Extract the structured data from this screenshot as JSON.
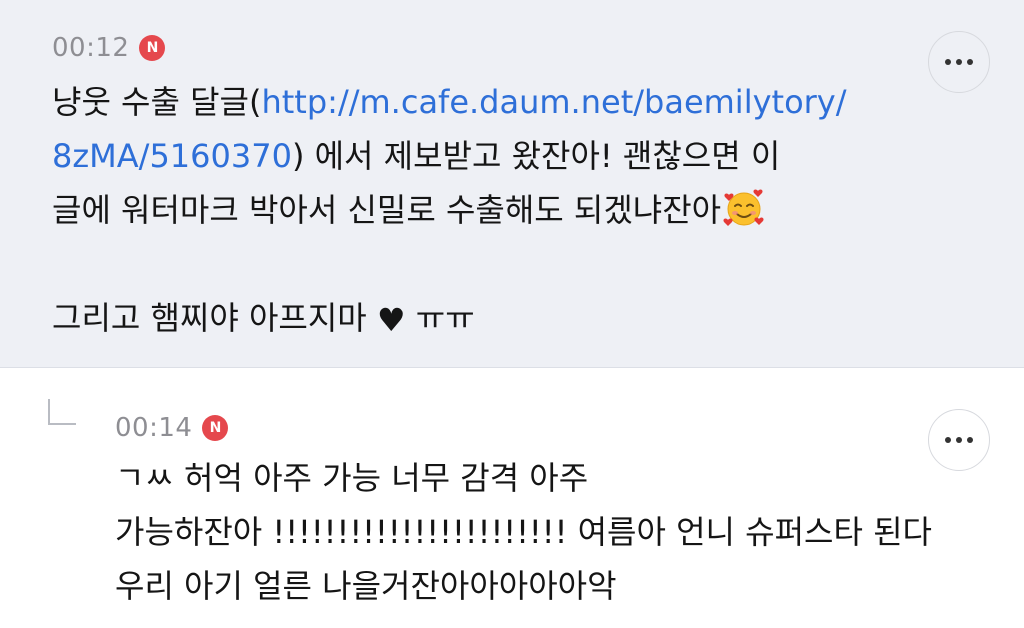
{
  "comments": [
    {
      "time": "00:12",
      "badge": "N",
      "lines": {
        "l1_text": "냥웃 수출 달글(",
        "l1_link": "http://m.cafe.daum.net/baemilytory/",
        "l2_link": "8zMA/5160370",
        "l2_text": ") 에서 제보받고 왔잔아! 괜찮으면 이",
        "l3_text": "글에 워터마크 박아서 신밀로 수출해도 되겠냐잔아",
        "l5_text": "그리고 햄찌야 아프지마",
        "l5_heart": "♥",
        "l5_tail": "ㅠㅠ"
      },
      "emoji": "smiling-face-with-hearts-icon"
    },
    {
      "time": "00:14",
      "badge": "N",
      "lines": {
        "l1_text": "ㄱㅆ 허억 아주 가능 너무 감격 아주",
        "l2_text": "가능하잔아 !!!!!!!!!!!!!!!!!!!!!!! 여름아 언니 슈퍼스타 된다",
        "l3_text": "우리 아기 얼른 나을거잔아아아아아악"
      }
    }
  ],
  "colors": {
    "first_comment_bg": "#eef0f5",
    "link": "#2e6fd8",
    "badge": "#e5484d",
    "time": "#8e8e93"
  }
}
